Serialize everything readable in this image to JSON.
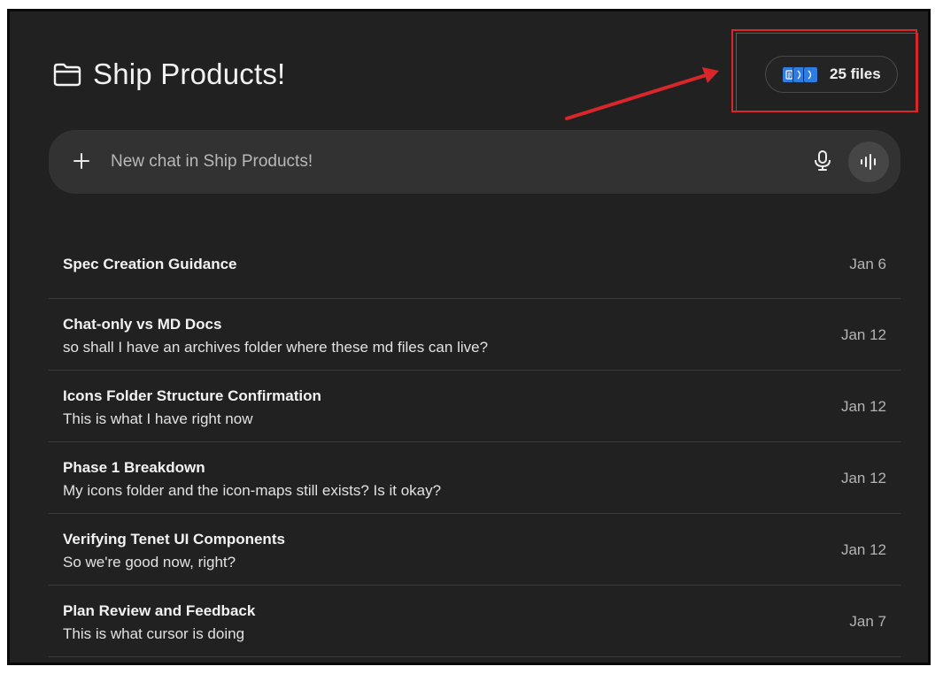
{
  "project": {
    "title": "Ship Products!",
    "folder_icon": "folder-icon"
  },
  "files": {
    "count_label": "25 files",
    "icon": "file-stack-icon",
    "accent_color": "#2f7de1"
  },
  "annotation": {
    "color": "#d8262b"
  },
  "composer": {
    "placeholder": "New chat in Ship Products!",
    "value": "",
    "plus_icon": "plus-icon",
    "mic_icon": "microphone-icon",
    "voice_icon": "voice-mode-icon"
  },
  "chats": [
    {
      "title": "Spec Creation Guidance",
      "snippet": "",
      "date": "Jan 6"
    },
    {
      "title": "Chat-only vs MD Docs",
      "snippet": "so shall I have an archives folder where these md files can live?",
      "date": "Jan 12"
    },
    {
      "title": "Icons Folder Structure Confirmation",
      "snippet": "This is what I have right now",
      "date": "Jan 12"
    },
    {
      "title": "Phase 1 Breakdown",
      "snippet": "My icons folder and the icon-maps still exists? Is it okay?",
      "date": "Jan 12"
    },
    {
      "title": "Verifying Tenet UI Components",
      "snippet": "So we're good now, right?",
      "date": "Jan 12"
    },
    {
      "title": "Plan Review and Feedback",
      "snippet": "This is what cursor is doing",
      "date": "Jan 7"
    }
  ]
}
